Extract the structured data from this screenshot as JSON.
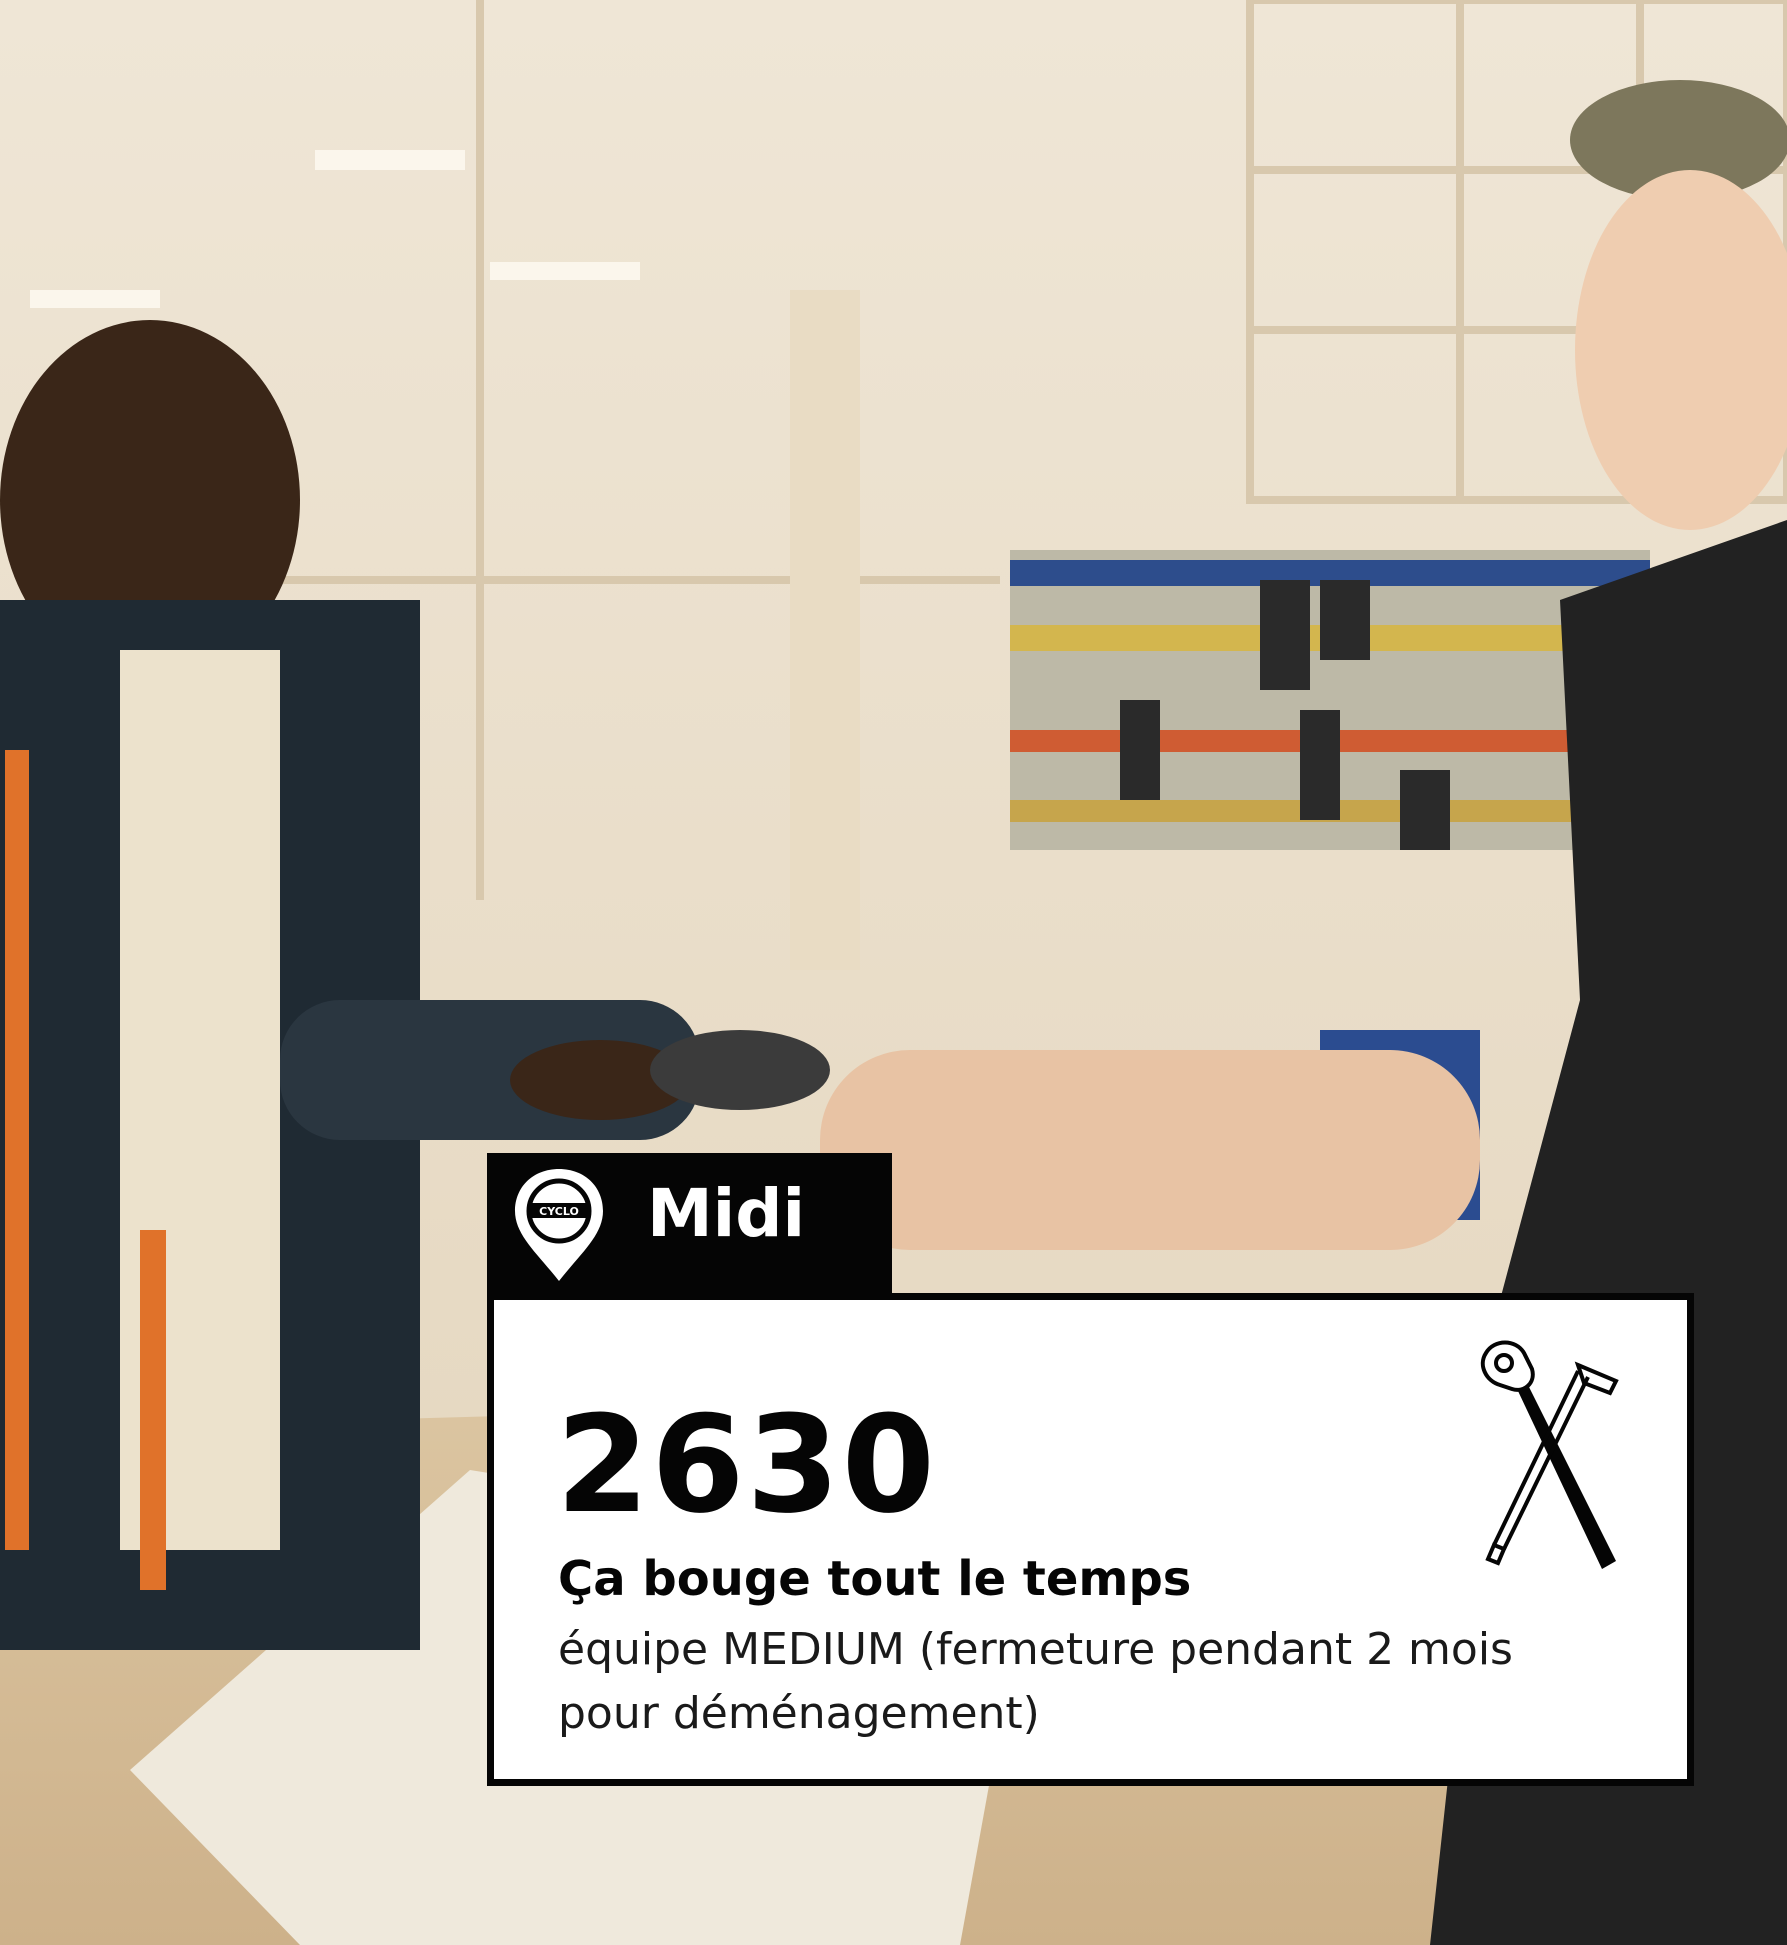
{
  "location": {
    "pin_icon": "map-pin-cyclo-icon",
    "logo_text": "CYCLO",
    "name": "Midi"
  },
  "card": {
    "count": "2630",
    "headline": "Ça bouge tout le temps",
    "description": "équipe MEDIUM (fermeture pendant 2 mois pour déménagement)",
    "icon": "tools-icon"
  },
  "colors": {
    "tag_background": "#050505",
    "card_background": "#ffffff",
    "text": "#050505"
  }
}
